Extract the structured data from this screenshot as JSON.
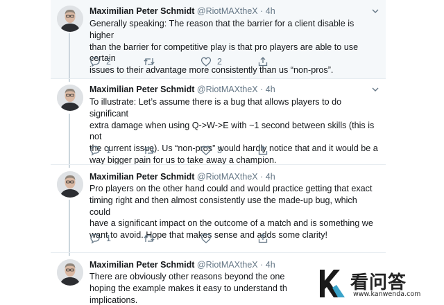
{
  "tweets": [
    {
      "author_name": "Maximilian Peter Schmidt",
      "handle": "@RiotMAXtheX",
      "separator": "·",
      "time": "4h",
      "lines": [
        "Generally speaking: The reason that the barrier for a client disable is higher",
        "than the barrier for competitive play is that pro players are able to use certain",
        "issues to their advantage more consistently than us “non-pros”."
      ],
      "reply_count": "2",
      "retweet_count": "",
      "like_count": "2",
      "highlighted": true
    },
    {
      "author_name": "Maximilian Peter Schmidt",
      "handle": "@RiotMAXtheX",
      "separator": "·",
      "time": "4h",
      "lines": [
        "To illustrate: Let’s assume there is a bug that allows players to do significant",
        "extra damage when using Q->W->E with ~1 second between skills (this is not",
        "the current issue). Us “non-pros” would hardly notice that and it would be a",
        "way bigger pain for us to take away a champion."
      ],
      "reply_count": "1",
      "retweet_count": "",
      "like_count": "3",
      "highlighted": false
    },
    {
      "author_name": "Maximilian Peter Schmidt",
      "handle": "@RiotMAXtheX",
      "separator": "·",
      "time": "4h",
      "lines": [
        "Pro players on the other hand could and would practice getting that exact",
        "timing right and then almost consistently use the made-up bug, which could",
        "have a significant impact on the outcome of a match and is something we",
        "want to avoid. Hope that makes sense and adds some clarity!"
      ],
      "reply_count": "1",
      "retweet_count": "",
      "like_count": "",
      "highlighted": false
    },
    {
      "author_name": "Maximilian Peter Schmidt",
      "handle": "@RiotMAXtheX",
      "separator": "·",
      "time": "4h",
      "lines": [
        "There are obviously other reasons beyond the one",
        "hoping the example makes it easy to understand th",
        "implications."
      ],
      "highlighted": false
    }
  ],
  "watermark": {
    "title": "看问答",
    "url": "www.kanwenda.com"
  },
  "icons": {
    "reply": "reply-icon",
    "retweet": "retweet-icon",
    "like": "like-icon",
    "share": "share-icon",
    "caret": "chevron-down-icon"
  },
  "colors": {
    "text": "#14171a",
    "muted": "#657786",
    "highlight_bg": "#f5f8fa",
    "thread_line": "#ccd6dd"
  }
}
